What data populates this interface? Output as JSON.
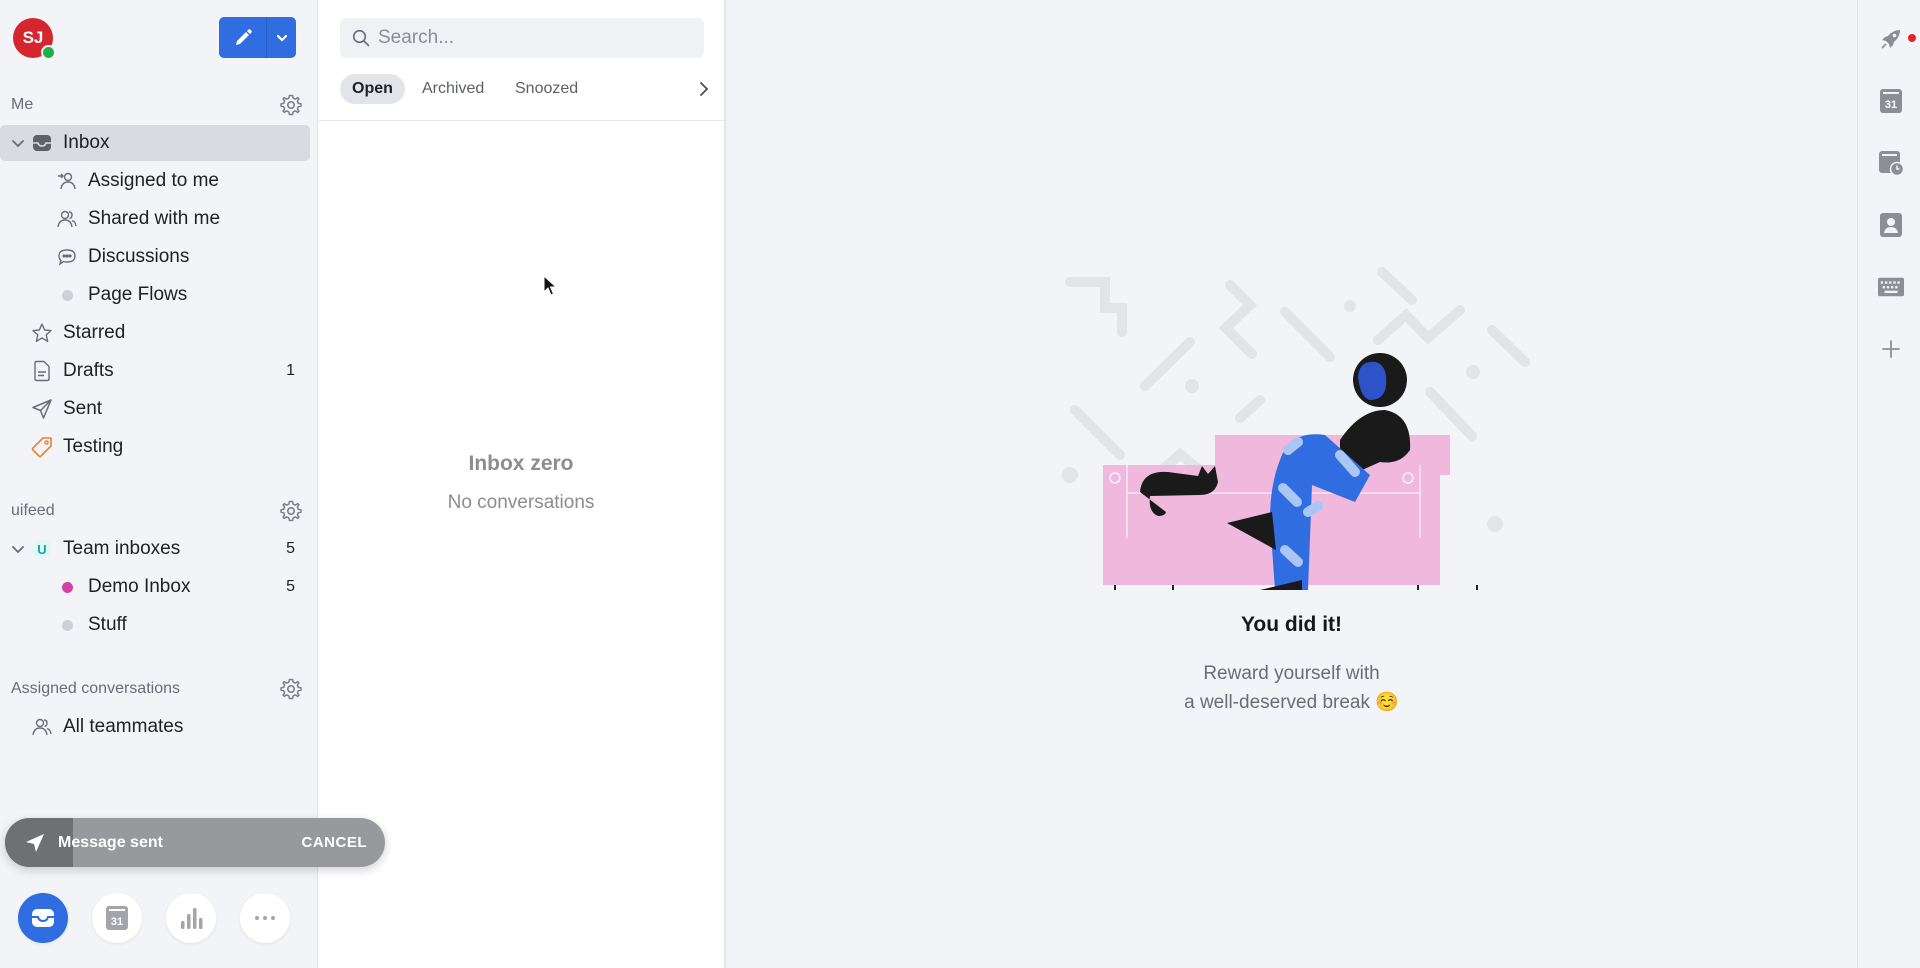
{
  "user": {
    "initials": "SJ",
    "avatar_color": "#d5262f",
    "presence": "online",
    "presence_color": "#1fae4a"
  },
  "colors": {
    "accent": "#2f6de0",
    "testing_tag": "#e8833a",
    "demo_inbox_dot": "#d63ea8",
    "neutral_dot": "#cfd0d5",
    "team_badge": "#16a7a0",
    "notification": "#e2232a"
  },
  "compose": {
    "compose_icon": "pencil-icon",
    "menu_icon": "chevron-down-icon"
  },
  "sidebar": {
    "me_section": {
      "title": "Me",
      "settings_icon": "gear-icon"
    },
    "me_items": [
      {
        "label": "Inbox",
        "icon": "inbox-icon",
        "expanded": true,
        "active": true
      },
      {
        "label": "Assigned to me",
        "icon": "assign-user-icon"
      },
      {
        "label": "Shared with me",
        "icon": "users-icon"
      },
      {
        "label": "Discussions",
        "icon": "chat-bubble-icon"
      },
      {
        "label": "Page Flows",
        "icon": "dot-icon"
      },
      {
        "label": "Starred",
        "icon": "star-icon"
      },
      {
        "label": "Drafts",
        "icon": "document-icon",
        "count": "1"
      },
      {
        "label": "Sent",
        "icon": "send-icon"
      },
      {
        "label": "Testing",
        "icon": "tag-icon"
      }
    ],
    "team_section": {
      "title": "uifeed",
      "settings_icon": "gear-icon"
    },
    "team_items": [
      {
        "label": "Team inboxes",
        "badge": "U",
        "count": "5",
        "expanded": true
      },
      {
        "label": "Demo Inbox",
        "count": "5"
      },
      {
        "label": "Stuff"
      }
    ],
    "assigned_section": {
      "title": "Assigned conversations",
      "settings_icon": "gear-icon"
    },
    "assigned_items": [
      {
        "label": "All teammates",
        "icon": "users-icon"
      }
    ]
  },
  "toast": {
    "message": "Message sent",
    "action": "CANCEL",
    "progress_percent": 18
  },
  "bottom_nav": [
    {
      "name": "inbox",
      "icon": "inbox-icon",
      "active": true
    },
    {
      "name": "calendar",
      "icon": "calendar-icon",
      "calendar_day": "31"
    },
    {
      "name": "analytics",
      "icon": "bar-chart-icon"
    },
    {
      "name": "more",
      "icon": "more-icon"
    }
  ],
  "list": {
    "search": {
      "placeholder": "Search...",
      "value": ""
    },
    "tabs": [
      {
        "label": "Open",
        "active": true
      },
      {
        "label": "Archived"
      },
      {
        "label": "Snoozed"
      }
    ],
    "more_tabs_icon": "chevron-right-icon",
    "empty_state": {
      "title": "Inbox zero",
      "subtitle": "No conversations"
    }
  },
  "main": {
    "empty_title": "You did it!",
    "empty_line1": "Reward yourself with",
    "empty_line2": "a well-deserved break ☺️"
  },
  "right_rail": [
    {
      "name": "rocket",
      "icon": "rocket-icon",
      "has_notification": true
    },
    {
      "name": "calendar",
      "icon": "calendar-icon",
      "calendar_day": "31"
    },
    {
      "name": "scheduled",
      "icon": "calendar-clock-icon"
    },
    {
      "name": "contacts",
      "icon": "contact-card-icon"
    },
    {
      "name": "shortcuts",
      "icon": "keyboard-icon"
    },
    {
      "name": "add",
      "icon": "plus-icon"
    }
  ]
}
